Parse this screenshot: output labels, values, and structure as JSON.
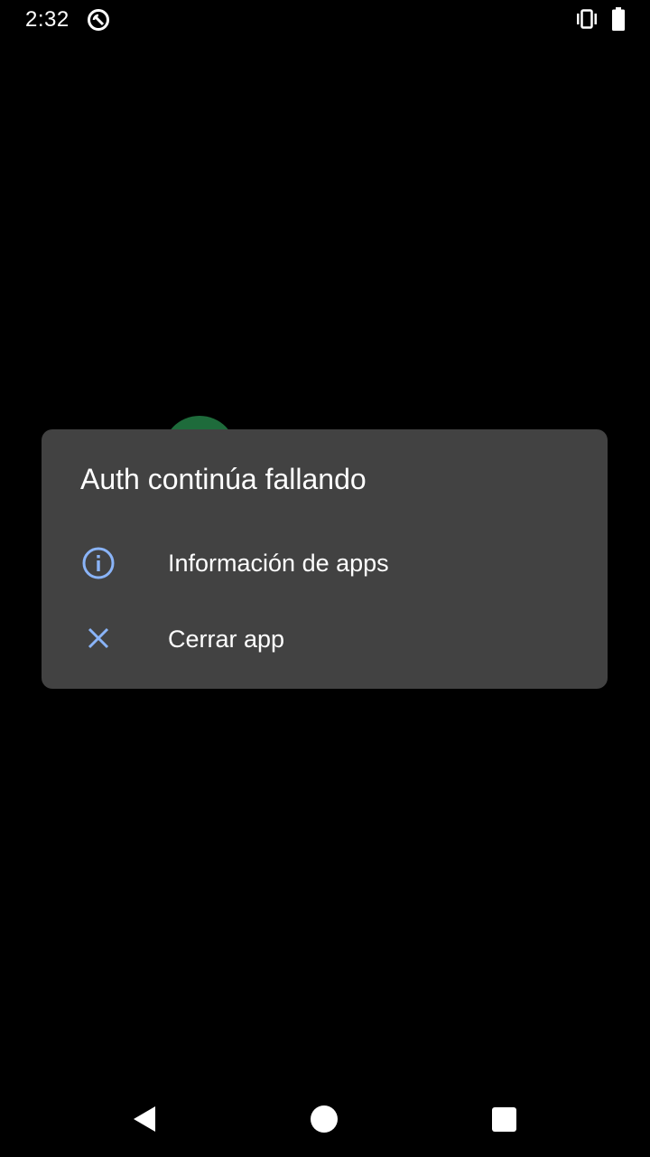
{
  "status_bar": {
    "time": "2:32",
    "icons": [
      "app-sync-icon",
      "vibrate-icon",
      "battery-icon"
    ]
  },
  "background": {
    "app_logo_color": "#1e6b3b"
  },
  "dialog": {
    "title": "Auth continúa fallando",
    "options": [
      {
        "label": "Información de apps",
        "icon": "info-icon"
      },
      {
        "label": "Cerrar app",
        "icon": "close-icon"
      }
    ],
    "background_color": "#424242",
    "accent_color": "#8ab4f8"
  },
  "nav_bar": {
    "buttons": [
      "back",
      "home",
      "recents"
    ]
  }
}
